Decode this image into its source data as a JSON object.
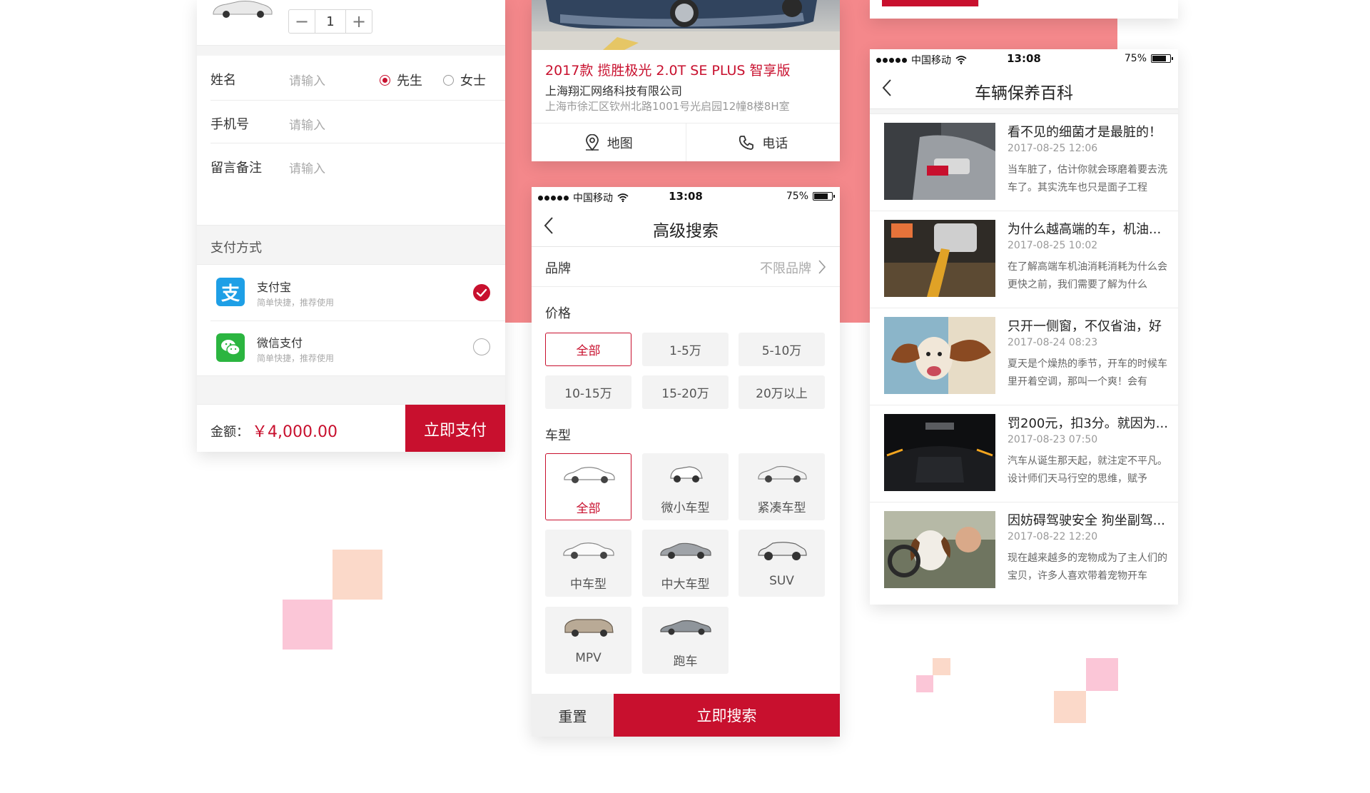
{
  "colors": {
    "accent": "#c8102e",
    "pink_bg": "#f4888b",
    "alipay": "#1e9fe6",
    "wechat": "#2bb540"
  },
  "order": {
    "quantity": "1",
    "name_label": "姓名",
    "name_placeholder": "请输入",
    "gender_male": "先生",
    "gender_female": "女士",
    "phone_label": "手机号",
    "phone_placeholder": "请输入",
    "note_label": "留言备注",
    "note_placeholder": "请输入",
    "payment_section": "支付方式",
    "payments": [
      {
        "name": "支付宝",
        "sub": "简单快捷，推荐使用",
        "icon": "alipay-icon",
        "selected": true
      },
      {
        "name": "微信支付",
        "sub": "简单快捷，推荐使用",
        "icon": "wechat-pay-icon",
        "selected": false
      }
    ],
    "amount_label": "金额：",
    "amount_value": "￥4,000.00",
    "pay_button": "立即支付"
  },
  "detail": {
    "title": "2017款 揽胜极光 2.0T SE PLUS 智享版",
    "dealer": "上海翔汇网络科技有限公司",
    "address": "上海市徐汇区钦州北路1001号光启园12幢8楼8H室",
    "map_label": "地图",
    "phone_label": "电话"
  },
  "status": {
    "carrier": "中国移动",
    "time": "13:08",
    "battery": "75%"
  },
  "search": {
    "title": "高级搜索",
    "brand_label": "品牌",
    "brand_value": "不限品牌",
    "price_title": "价格",
    "prices": [
      "全部",
      "1-5万",
      "5-10万",
      "10-15万",
      "15-20万",
      "20万以上"
    ],
    "price_selected": 0,
    "type_title": "车型",
    "types": [
      "全部",
      "微小车型",
      "紧凑车型",
      "中车型",
      "中大车型",
      "SUV",
      "MPV",
      "跑车"
    ],
    "type_selected": 0,
    "reset": "重置",
    "submit": "立即搜索"
  },
  "wiki": {
    "title": "车辆保养百科",
    "articles": [
      {
        "title": "看不见的细菌才是最脏的！",
        "date": "2017-08-25 12:06",
        "summary": "当车脏了，估计你就会琢磨着要去洗车了。其实洗车也只是面子工程"
      },
      {
        "title": "为什么越高端的车，机油...",
        "date": "2017-08-25 10:02",
        "summary": "在了解高端车机油消耗消耗为什么会更快之前，我们需要了解为什么"
      },
      {
        "title": "只开一侧窗，不仅省油，好",
        "date": "2017-08-24 08:23",
        "summary": "夏天是个燥热的季节，开车的时候车里开着空调，那叫一个爽！会有"
      },
      {
        "title": "罚200元，扣3分。就因为...",
        "date": "2017-08-23 07:50",
        "summary": "汽车从诞生那天起，就注定不平凡。设计师们天马行空的思维，赋予"
      },
      {
        "title": "因妨碍驾驶安全 狗坐副驾...",
        "date": "2017-08-22 12:20",
        "summary": "现在越来越多的宠物成为了主人们的宝贝，许多人喜欢带着宠物开车"
      }
    ]
  }
}
